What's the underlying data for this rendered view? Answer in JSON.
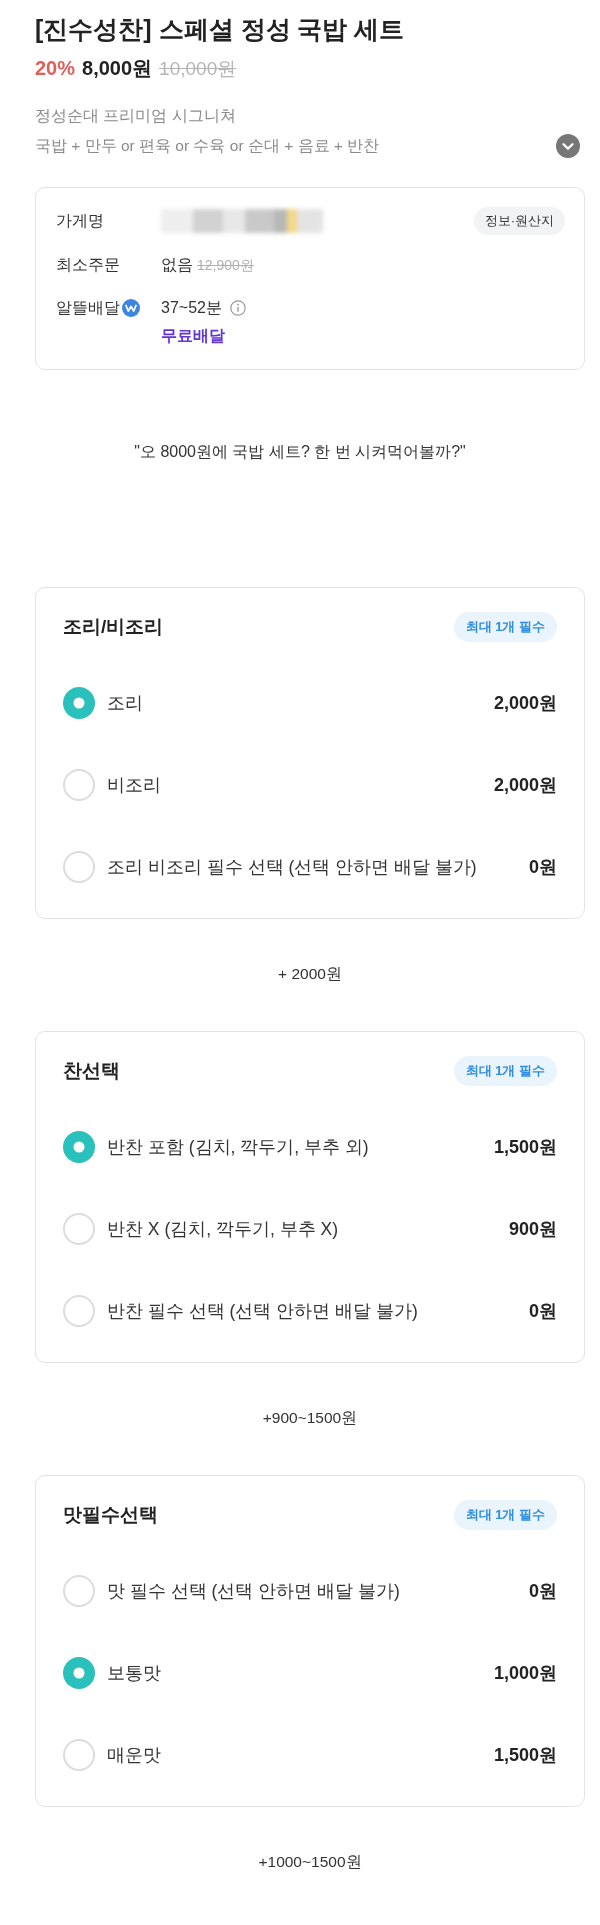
{
  "product": {
    "title": "[진수성찬] 스페셜 정성 국밥 세트",
    "discount": "20%",
    "price": "8,000원",
    "original_price": "10,000원",
    "subtitle": "정성순대 프리미엄 시그니쳐",
    "description": "국밥 + 만두 or 편육 or 수육 or 순대 + 음료 + 반찬",
    "expanded": false
  },
  "store_info": {
    "name_label": "가게명",
    "info_button": "정보·원산지",
    "min_order_label": "최소주문",
    "min_order_value": "없음",
    "min_order_original": "12,900원",
    "delivery_label": "알뜰배달",
    "delivery_time": "37~52분",
    "delivery_fee": "무료배달"
  },
  "quote": "\"오 8000원에 국밥 세트? 한 번 시켜먹어볼까?\"",
  "option_groups": [
    {
      "title": "조리/비조리",
      "badge": "최대 1개 필수",
      "options": [
        {
          "label": "조리",
          "price": "2,000원",
          "selected": true
        },
        {
          "label": "비조리",
          "price": "2,000원",
          "selected": false
        },
        {
          "label": "조리 비조리 필수 선택 (선택 안하면 배달 불가)",
          "price": "0원",
          "selected": false
        }
      ],
      "note": "+ 2000원"
    },
    {
      "title": "찬선택",
      "badge": "최대 1개 필수",
      "options": [
        {
          "label": "반찬 포함 (김치, 깍두기, 부추 외)",
          "price": "1,500원",
          "selected": true
        },
        {
          "label": "반찬 X (김치, 깍두기, 부추 X)",
          "price": "900원",
          "selected": false
        },
        {
          "label": "반찬 필수 선택 (선택 안하면 배달 불가)",
          "price": "0원",
          "selected": false
        }
      ],
      "note": "+900~1500원"
    },
    {
      "title": "맛필수선택",
      "badge": "최대 1개 필수",
      "options": [
        {
          "label": "맛 필수 선택 (선택 안하면 배달 불가)",
          "price": "0원",
          "selected": false
        },
        {
          "label": "보통맛",
          "price": "1,000원",
          "selected": true
        },
        {
          "label": "매운맛",
          "price": "1,500원",
          "selected": false
        }
      ],
      "note": "+1000~1500원"
    }
  ]
}
